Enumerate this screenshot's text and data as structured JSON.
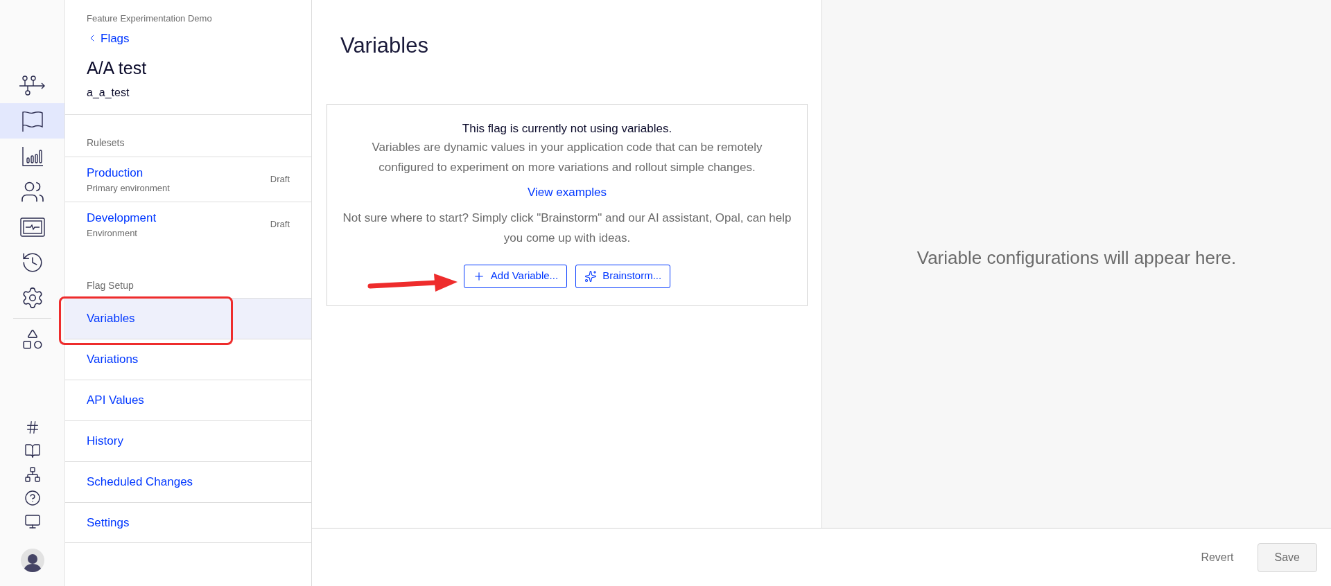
{
  "nav_rail": {
    "items": [
      {
        "kind": "flow",
        "selected": false
      },
      {
        "kind": "flag",
        "selected": true
      },
      {
        "kind": "chart",
        "selected": false
      },
      {
        "kind": "users",
        "selected": false
      },
      {
        "kind": "monitor",
        "selected": false
      },
      {
        "kind": "history",
        "selected": false
      },
      {
        "kind": "settings",
        "selected": false
      },
      {
        "kind": "shapes",
        "selected": false
      }
    ],
    "bottom_items": [
      {
        "kind": "hash"
      },
      {
        "kind": "book"
      },
      {
        "kind": "network"
      },
      {
        "kind": "help"
      },
      {
        "kind": "desktop"
      }
    ]
  },
  "sidebar": {
    "project": "Feature Experimentation Demo",
    "back_link": "Flags",
    "flag_name": "A/A test",
    "flag_key": "a_a_test",
    "rulesets": {
      "heading": "Rulesets",
      "items": [
        {
          "name": "Production",
          "description": "Primary environment",
          "status": "Draft"
        },
        {
          "name": "Development",
          "description": "Environment",
          "status": "Draft"
        }
      ]
    },
    "flag_setup": {
      "heading": "Flag Setup",
      "items": [
        {
          "label": "Variables",
          "selected": true
        },
        {
          "label": "Variations",
          "selected": false
        },
        {
          "label": "API Values",
          "selected": false
        },
        {
          "label": "History",
          "selected": false
        },
        {
          "label": "Scheduled Changes",
          "selected": false
        },
        {
          "label": "Settings",
          "selected": false
        }
      ]
    }
  },
  "main": {
    "title": "Variables",
    "empty_state": {
      "title": "This flag is currently not using variables.",
      "description": "Variables are dynamic values in your application code that can be remotely configured to experiment on more variations and rollout simple changes.",
      "link": "View examples",
      "hint": "Not sure where to start? Simply click \"Brainstorm\" and our AI assistant, Opal, can help you come up with ideas.",
      "buttons": [
        {
          "label": "Add Variable...",
          "kind": "add"
        },
        {
          "label": "Brainstorm...",
          "kind": "brainstorm"
        }
      ]
    }
  },
  "preview_panel": {
    "message": "Variable configurations will appear here."
  },
  "footer": {
    "buttons": [
      {
        "label": "Revert",
        "kind": "text"
      },
      {
        "label": "Save",
        "kind": "secondary"
      }
    ]
  }
}
